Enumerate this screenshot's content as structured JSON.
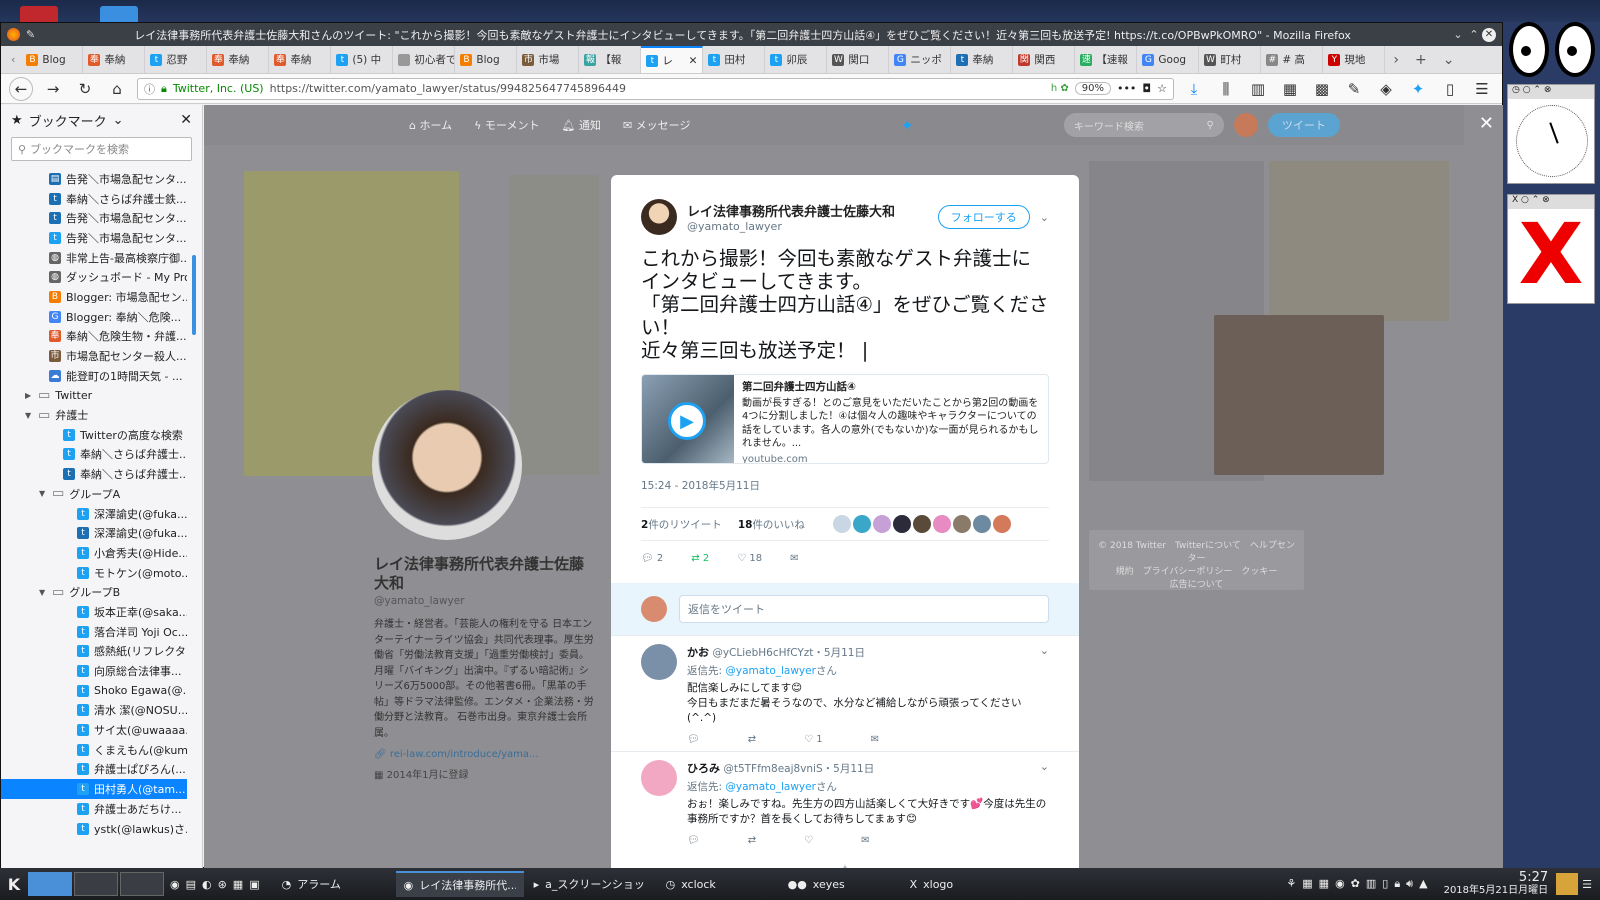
{
  "window": {
    "title": "レイ法律事務所代表弁護士佐藤大和さんのツイート: \"これから撮影！今回も素敵なゲスト弁護士にインタビューしてきます。「第二回弁護士四方山話④」をぜひご覧ください！近々第三回も放送予定! https://t.co/OPBwPkOMRO\" - Mozilla Firefox"
  },
  "tabs": [
    {
      "label": "Blog",
      "icon": "B",
      "color": "#f57d00"
    },
    {
      "label": "奉納",
      "icon": "奉",
      "color": "#e05a2b"
    },
    {
      "label": "忍野",
      "icon": "t",
      "color": "#1da1f2"
    },
    {
      "label": "奉納",
      "icon": "奉",
      "color": "#e05a2b"
    },
    {
      "label": "奉納",
      "icon": "奉",
      "color": "#e05a2b"
    },
    {
      "label": "(5) 中",
      "icon": "t",
      "color": "#1da1f2"
    },
    {
      "label": "初心者で",
      "icon": "",
      "color": "#999999"
    },
    {
      "label": "Blog",
      "icon": "B",
      "color": "#f57d00"
    },
    {
      "label": "市場",
      "icon": "市",
      "color": "#7a5c3d"
    },
    {
      "label": "【報",
      "icon": "報",
      "color": "#3ca3a3"
    },
    {
      "label": "レ",
      "icon": "t",
      "color": "#1da1f2"
    },
    {
      "label": "田村",
      "icon": "t",
      "color": "#1da1f2"
    },
    {
      "label": "卯辰",
      "icon": "t",
      "color": "#1da1f2"
    },
    {
      "label": "関口",
      "icon": "W",
      "color": "#555555"
    },
    {
      "label": "ニッポ",
      "icon": "G",
      "color": "#4285f4"
    },
    {
      "label": "奉納",
      "icon": "t",
      "color": "#1c6fb3"
    },
    {
      "label": "関西",
      "icon": "関",
      "color": "#c0392b"
    },
    {
      "label": "【速報",
      "icon": "速",
      "color": "#27ae60"
    },
    {
      "label": "Goog",
      "icon": "G",
      "color": "#4285f4"
    },
    {
      "label": "町村",
      "icon": "W",
      "color": "#555555"
    },
    {
      "label": "# 高",
      "icon": "#",
      "color": "#888888"
    },
    {
      "label": "現地",
      "icon": "Y",
      "color": "#cc0000"
    }
  ],
  "nav": {
    "site": "Twitter, Inc. (US)",
    "url": "https://twitter.com/yamato_lawyer/status/994825647745896449",
    "zoom": "90%"
  },
  "sidebar": {
    "title": "ブックマーク",
    "search_placeholder": "ブックマークを検索",
    "items": [
      {
        "label": "告発＼市場急配センタ...",
        "indent": 1,
        "icon": "▤",
        "color": "#1c6fb3"
      },
      {
        "label": "奉納＼さらば弁護士鉄...",
        "indent": 1,
        "icon": "t",
        "color": "#1c6fb3"
      },
      {
        "label": "告発＼市場急配センタ...",
        "indent": 1,
        "icon": "t",
        "color": "#1c6fb3"
      },
      {
        "label": "告発＼市場急配センタ...",
        "indent": 1,
        "icon": "t",
        "color": "#1da1f2"
      },
      {
        "label": "非常上告-最高検察庁御...",
        "indent": 1,
        "icon": "◍",
        "color": "#666666"
      },
      {
        "label": "ダッシュボード - My Pro...",
        "indent": 1,
        "icon": "◍",
        "color": "#666666"
      },
      {
        "label": "Blogger: 市場急配セン...",
        "indent": 1,
        "icon": "B",
        "color": "#f57d00"
      },
      {
        "label": "Blogger: 奉納＼危険...",
        "indent": 1,
        "icon": "G",
        "color": "#4285f4"
      },
      {
        "label": "奉納＼危険生物・弁護...",
        "indent": 1,
        "icon": "奉",
        "color": "#e05a2b"
      },
      {
        "label": "市場急配センター殺人...",
        "indent": 1,
        "icon": "市",
        "color": "#7a5c3d"
      },
      {
        "label": "能登町の1時間天気 - ...",
        "indent": 1,
        "icon": "☁",
        "color": "#3a7bd5"
      },
      {
        "label": "Twitter",
        "indent": 0,
        "icon": "folder",
        "color": "#777777",
        "arrow": "▶"
      },
      {
        "label": "弁護士",
        "indent": 0,
        "icon": "folder",
        "color": "#777777",
        "arrow": "▼"
      },
      {
        "label": "Twitterの高度な検索",
        "indent": 2,
        "icon": "t",
        "color": "#1da1f2"
      },
      {
        "label": "奉納＼さらば弁護士...",
        "indent": 2,
        "icon": "t",
        "color": "#1da1f2"
      },
      {
        "label": "奉納＼さらば弁護士...",
        "indent": 2,
        "icon": "t",
        "color": "#1c6fb3"
      },
      {
        "label": "グループA",
        "indent": 1,
        "icon": "folder",
        "color": "#777777",
        "arrow": "▼"
      },
      {
        "label": "深澤諭史(@fuka...",
        "indent": 3,
        "icon": "t",
        "color": "#1da1f2"
      },
      {
        "label": "深澤諭史(@fuka...",
        "indent": 3,
        "icon": "t",
        "color": "#1c6fb3"
      },
      {
        "label": "小倉秀夫(@Hide...",
        "indent": 3,
        "icon": "t",
        "color": "#1da1f2"
      },
      {
        "label": "モトケン(@moto...",
        "indent": 3,
        "icon": "t",
        "color": "#1da1f2"
      },
      {
        "label": "グループB",
        "indent": 1,
        "icon": "folder",
        "color": "#777777",
        "arrow": "▼"
      },
      {
        "label": "坂本正幸(@saka...",
        "indent": 3,
        "icon": "t",
        "color": "#1da1f2"
      },
      {
        "label": "落合洋司 Yoji Oc...",
        "indent": 3,
        "icon": "t",
        "color": "#1da1f2"
      },
      {
        "label": "感熱紙(リフレクタ...",
        "indent": 3,
        "icon": "t",
        "color": "#1da1f2"
      },
      {
        "label": "向原総合法律事...",
        "indent": 3,
        "icon": "t",
        "color": "#1da1f2"
      },
      {
        "label": "Shoko Egawa(@...",
        "indent": 3,
        "icon": "t",
        "color": "#1da1f2"
      },
      {
        "label": "清水 潔(@NOSU...",
        "indent": 3,
        "icon": "t",
        "color": "#1da1f2"
      },
      {
        "label": "サイ太(@uwaaaa...",
        "indent": 3,
        "icon": "t",
        "color": "#1da1f2"
      },
      {
        "label": "くまえもん(@kum...",
        "indent": 3,
        "icon": "t",
        "color": "#1da1f2"
      },
      {
        "label": "弁護士ぱぴろん(...",
        "indent": 3,
        "icon": "t",
        "color": "#1da1f2"
      },
      {
        "label": "田村勇人(@tam...",
        "indent": 3,
        "icon": "t",
        "color": "#1da1f2",
        "selected": true
      },
      {
        "label": "弁護士あだちけ...",
        "indent": 3,
        "icon": "t",
        "color": "#1da1f2"
      },
      {
        "label": "ystk(@lawkus)さ...",
        "indent": 3,
        "icon": "t",
        "color": "#1da1f2"
      }
    ]
  },
  "twitter_nav": {
    "home": "ホーム",
    "moments": "モーメント",
    "notifications": "通知",
    "messages": "メッセージ",
    "search_placeholder": "キーワード検索",
    "tweet_button": "ツイート"
  },
  "profile": {
    "name": "レイ法律事務所代表弁護士佐藤大和",
    "handle": "@yamato_lawyer",
    "bio": "弁護士・経営者。「芸能人の権利を守る 日本エンターテイナーライツ協会」共同代表理事。厚生労働省「労働法教育支援」「過重労働検討」委員。月曜「バイキング」出演中。『ずるい暗記術』シリーズ6万5000部。その他著書6冊。「黒革の手帖」等ドラマ法律監修。エンタメ・企業法務・労働分野と法教育。 石巻市出身。東京弁護士会所属。",
    "link": "rei-law.com/introduce/yama...",
    "joined": "2014年1月に登録"
  },
  "tweet": {
    "name": "レイ法律事務所代表弁護士佐藤大和",
    "handle": "@yamato_lawyer",
    "follow": "フォローする",
    "text": "これから撮影！今回も素敵なゲスト弁護士にインタビューしてきます。\n「第二回弁護士四方山話④」をぜひご覧ください！\n近々第三回も放送予定！ |",
    "card": {
      "title": "第二回弁護士四方山話④",
      "desc": "動画が長すぎる！とのご意見をいただいたことから第2回の動画を4つに分割しました！④は個々人の趣味やキャラクターについての話をしています。各人の意外(でもないか)な一面が見られるかもしれません。...",
      "domain": "youtube.com"
    },
    "timestamp": "15:24 - 2018年5月11日",
    "retweets_num": "2",
    "retweets_label": "件のリツイート",
    "likes_num": "18",
    "likes_label": "件のいいね",
    "liker_colors": [
      "#c9d6e3",
      "#3aa7c9",
      "#c7a0d8",
      "#2b2b3a",
      "#5a4a3a",
      "#e78bc2",
      "#8a7a6a",
      "#6d8aa0",
      "#d47a5a"
    ],
    "reply_count": "2",
    "retweet_count": "2",
    "like_count": "18",
    "reply_placeholder": "返信をツイート"
  },
  "replies": [
    {
      "name": "かお",
      "handle": "@yCLiebH6cHfCYzt",
      "date": "・5月11日",
      "to_label": "返信先:",
      "to": "@yamato_lawyer",
      "to_suffix": "さん",
      "body": "配信楽しみにしてます😊\n今日もまだまだ暑そうなので、水分など補給しながら頑張ってください(^.^)",
      "like_count": "1",
      "avatar": "#7a8fa8"
    },
    {
      "name": "ひろみ",
      "handle": "@t5TFfm8eaj8vniS",
      "date": "・5月11日",
      "to_label": "返信先:",
      "to": "@yamato_lawyer",
      "to_suffix": "さん",
      "body": "おぉ！楽しみですね。先生方の四方山話楽しくて大好きです💕今度は先生の事務所ですか？首を長くしてお待ちしてまぁす😊",
      "like_count": "",
      "avatar": "#f2a7c3"
    }
  ],
  "footer_links": "© 2018 Twitter　Twitterについて　ヘルプセンター\n規約　プライバシーポリシー　クッキー\n広告について",
  "taskbar": {
    "items": [
      {
        "label": "アラーム",
        "icon": "◔"
      },
      {
        "label": "レイ法律事務所代...",
        "icon": "◉",
        "active": true
      },
      {
        "label": "a_スクリーンショット ...",
        "icon": "▸"
      },
      {
        "label": "xclock",
        "icon": "◷"
      },
      {
        "label": "xeyes",
        "icon": "●●"
      },
      {
        "label": "xlogo",
        "icon": "X"
      }
    ],
    "time": "5:27",
    "date": "2018年5月21日月曜日"
  }
}
